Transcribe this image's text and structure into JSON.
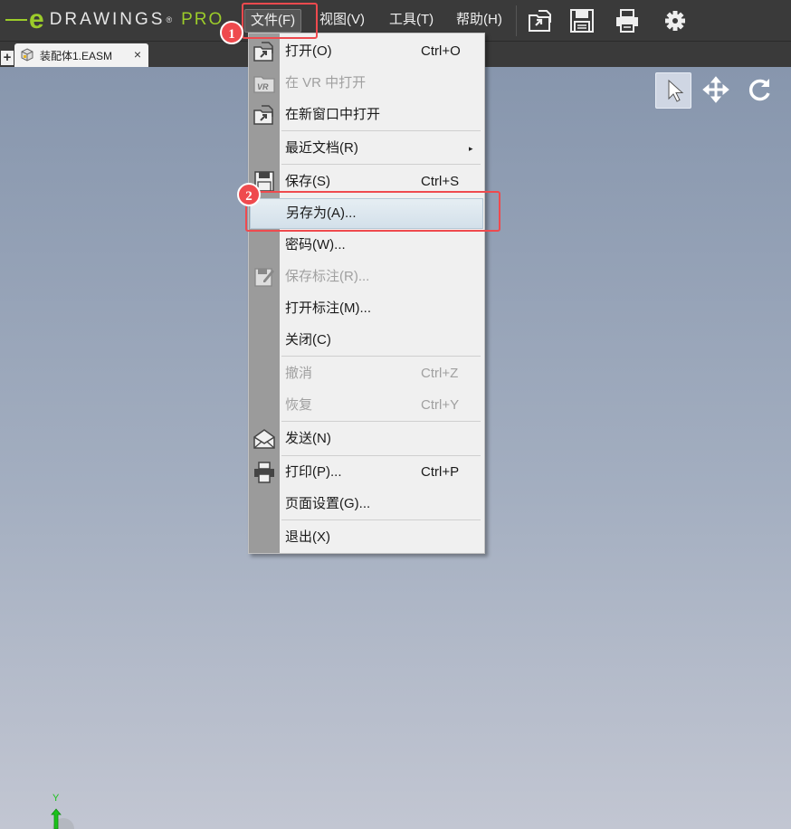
{
  "app": {
    "logo_e": "e",
    "logo_drawings": "DRAWINGS",
    "logo_reg": "®",
    "logo_pro": "PRO"
  },
  "menubar": [
    {
      "label": "文件(F)"
    },
    {
      "label": "视图(V)"
    },
    {
      "label": "工具(T)"
    },
    {
      "label": "帮助(H)"
    }
  ],
  "toolbar": {
    "icons": [
      "open-file-icon",
      "save-icon",
      "print-icon",
      "gear-icon"
    ]
  },
  "tabs": {
    "plus": "+",
    "active": {
      "label": "装配体1.EASM",
      "close": "×"
    }
  },
  "view_tools": [
    "select-arrow-icon",
    "pan-icon",
    "rotate-icon"
  ],
  "file_menu": {
    "items": [
      {
        "label": "打开(O)",
        "shortcut": "Ctrl+O",
        "icon": "open-icon",
        "disabled": false
      },
      {
        "label": "在 VR 中打开",
        "shortcut": "",
        "icon": "vr-icon",
        "disabled": true
      },
      {
        "label": "在新窗口中打开",
        "shortcut": "",
        "icon": "open-new-window-icon",
        "disabled": false
      },
      {
        "label": "最近文档(R)",
        "shortcut": "",
        "icon": "",
        "disabled": false,
        "submenu": "▸"
      },
      {
        "label": "保存(S)",
        "shortcut": "Ctrl+S",
        "icon": "save-icon",
        "disabled": false
      },
      {
        "label": "另存为(A)...",
        "shortcut": "",
        "icon": "",
        "disabled": false,
        "hover": true
      },
      {
        "label": "密码(W)...",
        "shortcut": "",
        "icon": "",
        "disabled": false
      },
      {
        "label": "保存标注(R)...",
        "shortcut": "",
        "icon": "save-markup-icon",
        "disabled": true
      },
      {
        "label": "打开标注(M)...",
        "shortcut": "",
        "icon": "",
        "disabled": false
      },
      {
        "label": "关闭(C)",
        "shortcut": "",
        "icon": "",
        "disabled": false
      },
      {
        "label": "撤消",
        "shortcut": "Ctrl+Z",
        "icon": "",
        "disabled": true
      },
      {
        "label": "恢复",
        "shortcut": "Ctrl+Y",
        "icon": "",
        "disabled": true
      },
      {
        "label": "发送(N)",
        "shortcut": "",
        "icon": "send-mail-icon",
        "disabled": false
      },
      {
        "label": "打印(P)...",
        "shortcut": "Ctrl+P",
        "icon": "print-icon",
        "disabled": false
      },
      {
        "label": "页面设置(G)...",
        "shortcut": "",
        "icon": "",
        "disabled": false
      },
      {
        "label": "退出(X)",
        "shortcut": "",
        "icon": "",
        "disabled": false
      }
    ]
  },
  "annotations": [
    {
      "number": "1",
      "color": "#ef4a4e"
    },
    {
      "number": "2",
      "color": "#ef4a4e"
    }
  ],
  "axis": {
    "y_label": "Y",
    "color": "#1bc21b"
  },
  "colors": {
    "accent": "#9ccc2a",
    "highlight": "#ef4a4e",
    "topbar": "#3a3a3a"
  }
}
